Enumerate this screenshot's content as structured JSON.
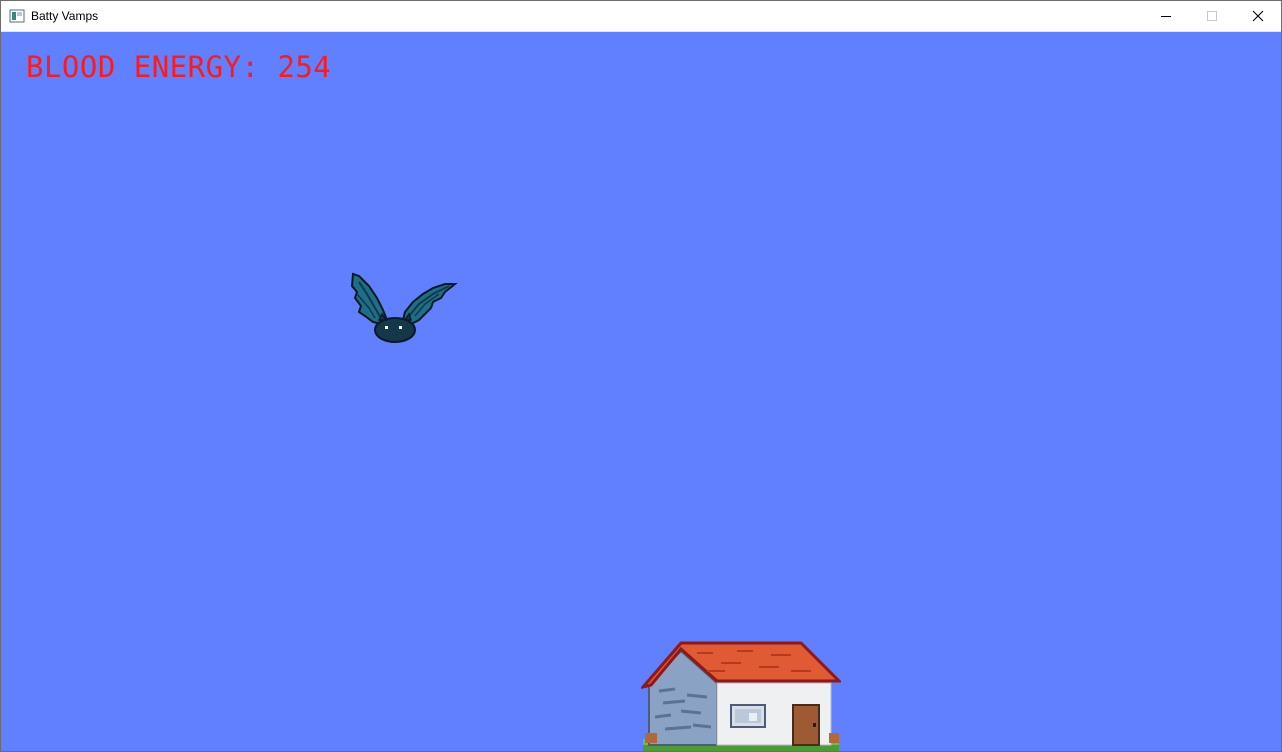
{
  "window": {
    "title": "Batty Vamps",
    "app_icon": "window-app-icon",
    "controls": [
      "minimize-icon",
      "maximize-icon",
      "close-icon"
    ]
  },
  "hud": {
    "label": "BLOOD ENERGY:",
    "value": "254",
    "color": "#ff1a1a"
  },
  "scene": {
    "sky_color": "#6080ff",
    "player": "bat-sprite",
    "building": "house-sprite"
  }
}
